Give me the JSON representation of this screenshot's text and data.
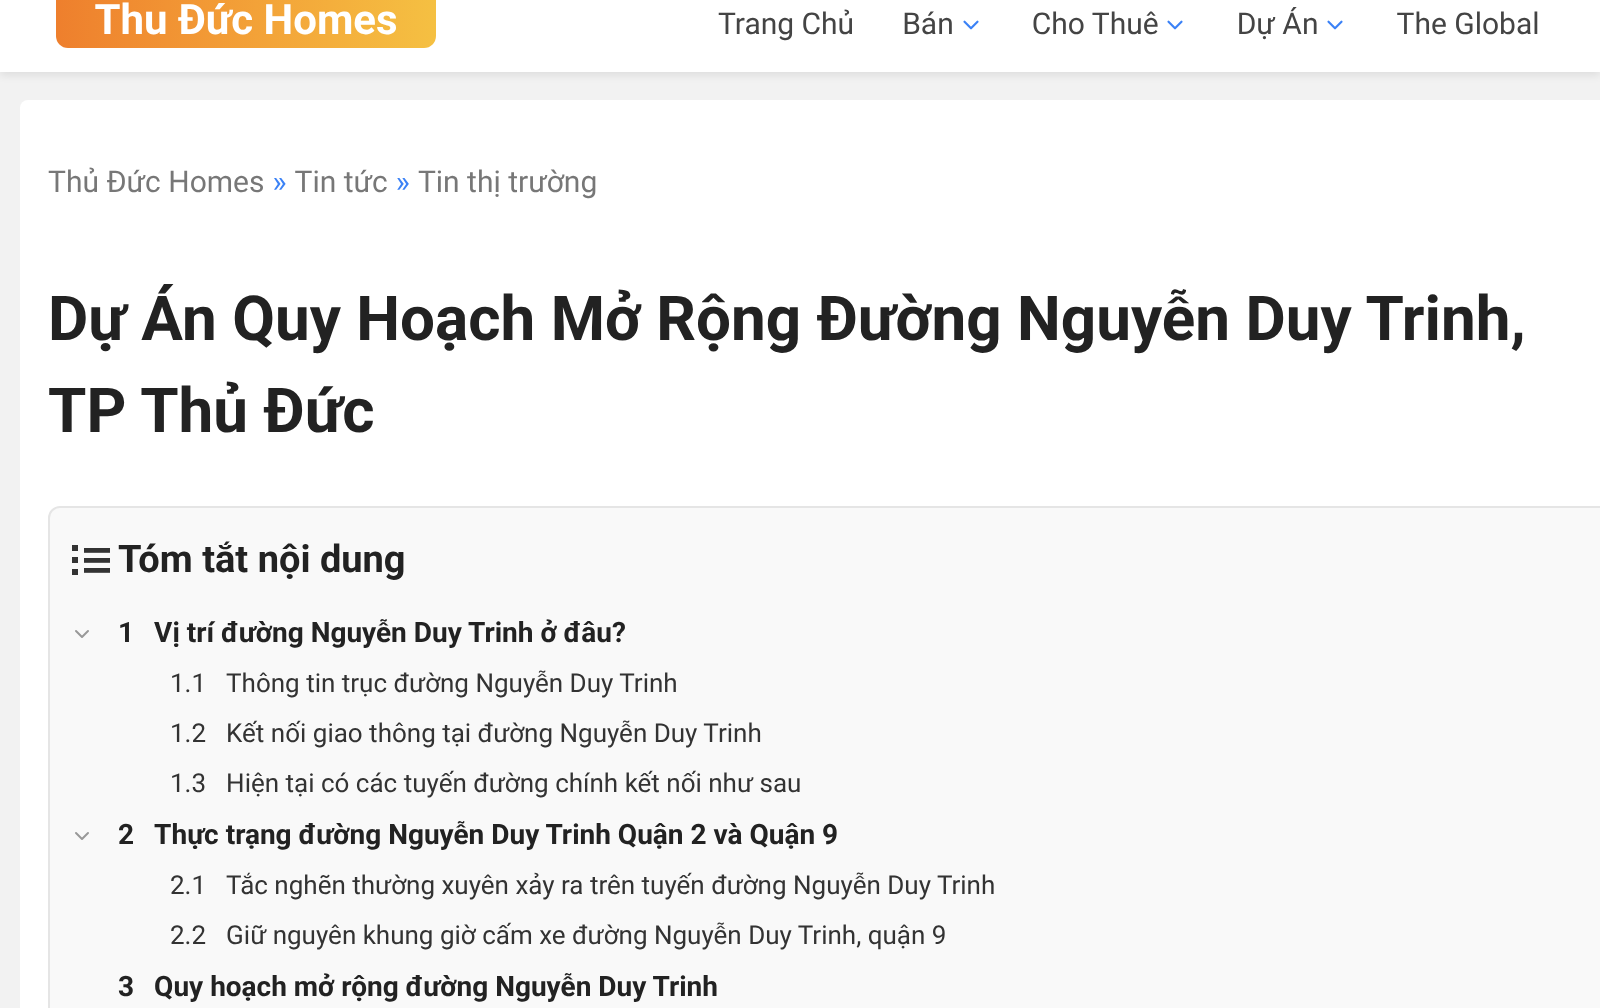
{
  "header": {
    "logo": "Thu Đức Homes",
    "nav": [
      {
        "label": "Trang Chủ",
        "has_menu": false
      },
      {
        "label": "Bán",
        "has_menu": true
      },
      {
        "label": "Cho Thuê",
        "has_menu": true
      },
      {
        "label": "Dự Án",
        "has_menu": true
      },
      {
        "label": "The Global",
        "has_menu": false
      }
    ]
  },
  "breadcrumb": [
    "Thủ Đức Homes",
    "Tin tức",
    "Tin thị trường"
  ],
  "breadcrumb_separator": "»",
  "title": "Dự Án Quy Hoạch Mở Rộng Đường Nguyễn Duy Trinh, TP Thủ Đức",
  "toc": {
    "title": "Tóm tắt nội dung",
    "items": [
      {
        "number": "1",
        "label": "Vị trí đường Nguyễn Duy Trinh ở đâu?",
        "expanded": true,
        "children": [
          {
            "number": "1.1",
            "label": "Thông tin trục đường Nguyễn Duy Trinh"
          },
          {
            "number": "1.2",
            "label": "Kết nối giao thông tại đường Nguyễn Duy Trinh"
          },
          {
            "number": "1.3",
            "label": "Hiện tại có các tuyến đường chính kết nối như sau"
          }
        ]
      },
      {
        "number": "2",
        "label": "Thực trạng đường Nguyễn Duy Trinh Quận 2 và Quận 9",
        "expanded": true,
        "children": [
          {
            "number": "2.1",
            "label": "Tắc nghẽn thường xuyên xảy ra trên tuyến đường Nguyễn Duy Trinh"
          },
          {
            "number": "2.2",
            "label": "Giữ nguyên khung giờ cấm xe đường Nguyễn Duy Trinh, quận 9"
          }
        ]
      },
      {
        "number": "3",
        "label": "Quy hoạch mở rộng đường Nguyễn Duy Trinh"
      }
    ]
  }
}
